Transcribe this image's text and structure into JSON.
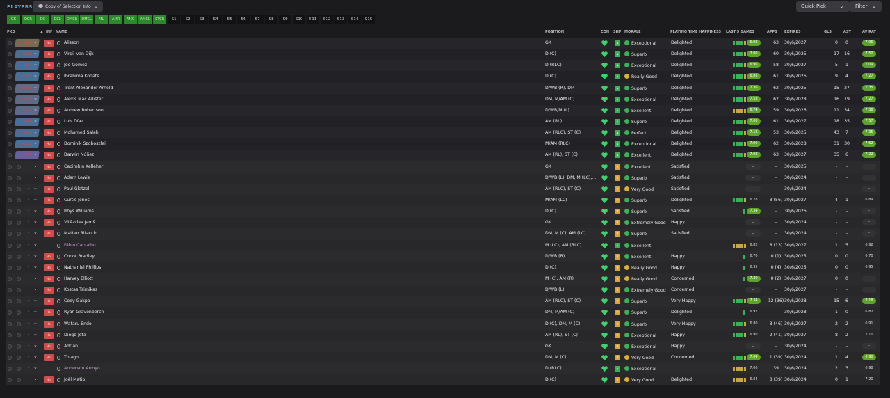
{
  "header": {
    "section_title": "PLAYERS",
    "view_label": "Copy of Selection Info",
    "quick_pick": "Quick Pick",
    "filter": "Filter"
  },
  "positions": [
    "GK",
    "DCR",
    "DC",
    "DCL",
    "DMCR",
    "DMCL",
    "ML",
    "AMR",
    "AMC",
    "AMCL",
    "STCR"
  ],
  "subs": [
    "S1",
    "S2",
    "S3",
    "S4",
    "S5",
    "S6",
    "S7",
    "S8",
    "S9",
    "S10",
    "S11",
    "S12",
    "S13",
    "S14",
    "S15"
  ],
  "columns": {
    "pkd": "PKD",
    "inf": "INF",
    "name": "NAME",
    "position": "POSITION",
    "con": "CON",
    "shp": "SHP",
    "morale": "MORALE",
    "pth": "PLAYING TIME HAPPINESS",
    "last5": "LAST 5 GAMES",
    "apps": "APPS",
    "expires": "EXPIRES",
    "gls": "GLS",
    "ast": "AST",
    "avrat": "AV RAT"
  },
  "players": [
    {
      "slot": "GK",
      "name": "Alisson",
      "position": "GK",
      "morale": "Exceptional",
      "pth": "Delighted",
      "last5": "6.98",
      "apps": "63",
      "expires": "30/6/2027",
      "gls": "0",
      "ast": "0",
      "avrat": "7.06",
      "green5": true
    },
    {
      "slot": "DCR",
      "name": "Virgil van Dijk",
      "position": "D (C)",
      "morale": "Superb",
      "pth": "Delighted",
      "last5": "7.06",
      "apps": "60",
      "expires": "30/6/2025",
      "gls": "17",
      "ast": "16",
      "avrat": "7.50",
      "green5": true
    },
    {
      "slot": "DC",
      "name": "Joe Gomez",
      "position": "D (RLC)",
      "morale": "Exceptional",
      "pth": "Delighted",
      "last5": "6.96",
      "apps": "58",
      "expires": "30/6/2027",
      "gls": "5",
      "ast": "1",
      "avrat": "7.09",
      "green5": true
    },
    {
      "slot": "DCL",
      "name": "Ibrahima Konaté",
      "position": "D (C)",
      "morale": "Really Good",
      "pth": "Delighted",
      "last5": "6.88",
      "apps": "61",
      "expires": "30/6/2026",
      "gls": "9",
      "ast": "4",
      "avrat": "7.27",
      "green5": true
    },
    {
      "slot": "DMCR",
      "name": "Trent Alexander-Arnold",
      "position": "D/WB (R), DM",
      "morale": "Superb",
      "pth": "Delighted",
      "last5": "7.36",
      "apps": "62",
      "expires": "30/6/2025",
      "gls": "15",
      "ast": "27",
      "avrat": "7.35",
      "green5": true
    },
    {
      "slot": "DMCL",
      "name": "Alexis Mac Allister",
      "position": "DM, M/AM (C)",
      "morale": "Exceptional",
      "pth": "Delighted",
      "last5": "7.58",
      "apps": "62",
      "expires": "30/6/2028",
      "gls": "16",
      "ast": "19",
      "avrat": "7.27",
      "green5": true
    },
    {
      "slot": "ML",
      "name": "Andrew Robertson",
      "position": "D/WB/M (L)",
      "morale": "Excellent",
      "pth": "Delighted",
      "last5": "6.74",
      "apps": "59",
      "expires": "30/6/2026",
      "gls": "11",
      "ast": "34",
      "avrat": "7.38",
      "green5": false
    },
    {
      "slot": "AMR",
      "name": "Luis Díaz",
      "position": "AM (RL)",
      "morale": "Superb",
      "pth": "Delighted",
      "last5": "7.06",
      "apps": "61",
      "expires": "30/6/2027",
      "gls": "18",
      "ast": "35",
      "avrat": "7.57",
      "green5": true
    },
    {
      "slot": "AMC",
      "name": "Mohamed Salah",
      "position": "AM (RLC), ST (C)",
      "morale": "Perfect",
      "pth": "Delighted",
      "last5": "7.18",
      "apps": "53",
      "expires": "30/6/2025",
      "gls": "43",
      "ast": "7",
      "avrat": "7.35",
      "green5": true
    },
    {
      "slot": "AMCL",
      "name": "Dominik Szoboszlai",
      "position": "M/AM (RLC)",
      "morale": "Exceptional",
      "pth": "Delighted",
      "last5": "7.06",
      "apps": "62",
      "expires": "30/6/2028",
      "gls": "31",
      "ast": "30",
      "avrat": "7.62",
      "green5": true
    },
    {
      "slot": "STCR",
      "name": "Darwin Núñez",
      "position": "AM (RL), ST (C)",
      "morale": "Excellent",
      "pth": "Delighted",
      "last5": "7.98",
      "apps": "63",
      "expires": "30/6/2027",
      "gls": "35",
      "ast": "6",
      "avrat": "7.22",
      "green5": true
    },
    {
      "slot": "",
      "name": "Caoimhin Kelleher",
      "position": "GK",
      "morale": "Excellent",
      "pth": "Satisfied",
      "last5": "-",
      "apps": "-",
      "expires": "30/6/2025",
      "gls": "-",
      "ast": "-",
      "avrat": "-"
    },
    {
      "slot": "",
      "name": "Adam Lewis",
      "position": "D/WB (L), DM, M (LC),...",
      "morale": "Superb",
      "pth": "Satisfied",
      "last5": "-",
      "apps": "-",
      "expires": "30/6/2024",
      "gls": "-",
      "ast": "-",
      "avrat": "-"
    },
    {
      "slot": "",
      "name": "Paul Glatzel",
      "position": "AM (RLC), ST (C)",
      "morale": "Very Good",
      "pth": "Satisfied",
      "last5": "-",
      "apps": "-",
      "expires": "30/6/2024",
      "gls": "-",
      "ast": "-",
      "avrat": "-"
    },
    {
      "slot": "",
      "name": "Curtis Jones",
      "position": "M/AM (LC)",
      "morale": "Superb",
      "pth": "Delighted",
      "last5": "6.78",
      "apps": "3 (56)",
      "expires": "30/6/2027",
      "gls": "4",
      "ast": "1",
      "avrat": "6.89",
      "green5": true,
      "plain": true
    },
    {
      "slot": "",
      "name": "Rhys Williams",
      "position": "D (C)",
      "morale": "Superb",
      "pth": "Satisfied",
      "last5": "7.34",
      "apps": "-",
      "expires": "30/6/2026",
      "gls": "-",
      "ast": "-",
      "avrat": "-",
      "single": true
    },
    {
      "slot": "",
      "name": "Vitězslav Jaroš",
      "position": "GK",
      "morale": "Extremely Good",
      "pth": "Happy",
      "last5": "-",
      "apps": "-",
      "expires": "30/6/2024",
      "gls": "-",
      "ast": "-",
      "avrat": "-"
    },
    {
      "slot": "",
      "name": "Matteo Ritaccio",
      "position": "DM, M (C), AM (LC)",
      "morale": "Superb",
      "pth": "Satisfied",
      "last5": "-",
      "apps": "-",
      "expires": "30/6/2024",
      "gls": "-",
      "ast": "-",
      "avrat": "-"
    },
    {
      "slot": "",
      "name": "Fábio Carvalho",
      "position": "M (LC), AM (RLC)",
      "morale": "Excellent",
      "pth": "",
      "last5": "6.82",
      "apps": "8 (13)",
      "expires": "30/6/2027",
      "gls": "1",
      "ast": "5",
      "avrat": "6.92",
      "loan": true,
      "yellow5": true,
      "plain": true
    },
    {
      "slot": "",
      "name": "Conor Bradley",
      "position": "D/WB (R)",
      "morale": "Excellent",
      "pth": "Happy",
      "last5": "6.70",
      "apps": "0 (1)",
      "expires": "30/6/2025",
      "gls": "0",
      "ast": "0",
      "avrat": "6.70",
      "plain": true,
      "single": true
    },
    {
      "slot": "",
      "name": "Nathaniel Phillips",
      "position": "D (C)",
      "morale": "Really Good",
      "pth": "Happy",
      "last5": "6.95",
      "apps": "0 (4)",
      "expires": "30/6/2025",
      "gls": "0",
      "ast": "0",
      "avrat": "6.95",
      "plain": true,
      "single": true
    },
    {
      "slot": "",
      "name": "Harvey Elliott",
      "position": "M (C), AM (R)",
      "morale": "Really Good",
      "pth": "Concerned",
      "last5": "7.30",
      "apps": "0 (2)",
      "expires": "30/6/2027",
      "gls": "0",
      "ast": "0",
      "avrat": "-",
      "single": true
    },
    {
      "slot": "",
      "name": "Kostas Tsimikas",
      "position": "D/WB (L)",
      "morale": "Extremely Good",
      "pth": "Concerned",
      "last5": "-",
      "apps": "-",
      "expires": "30/6/2027",
      "gls": "-",
      "ast": "-",
      "avrat": "-"
    },
    {
      "slot": "",
      "name": "Cody Gakpo",
      "position": "AM (RLC), ST (C)",
      "morale": "Superb",
      "pth": "Very Happy",
      "last5": "7.34",
      "apps": "12 (36)",
      "expires": "30/6/2028",
      "gls": "15",
      "ast": "6",
      "avrat": "7.18",
      "green5": true
    },
    {
      "slot": "",
      "name": "Ryan Gravenberch",
      "position": "DM, M/AM (C)",
      "morale": "Superb",
      "pth": "Delighted",
      "last5": "6.92",
      "apps": "-",
      "expires": "30/6/2028",
      "gls": "1",
      "ast": "0",
      "avrat": "6.87",
      "plain": true,
      "single": true
    },
    {
      "slot": "",
      "name": "Wataru Endo",
      "position": "D (C), DM, M (C)",
      "morale": "Superb",
      "pth": "Very Happy",
      "last5": "6.80",
      "apps": "3 (46)",
      "expires": "30/6/2027",
      "gls": "2",
      "ast": "2",
      "avrat": "6.91",
      "green5": true,
      "plain": true
    },
    {
      "slot": "",
      "name": "Diogo Jota",
      "position": "AM (RL), ST (C)",
      "morale": "Exceptional",
      "pth": "Happy",
      "last5": "6.90",
      "apps": "2 (41)",
      "expires": "30/6/2027",
      "gls": "8",
      "ast": "2",
      "avrat": "7.10",
      "green5": true,
      "plain": true
    },
    {
      "slot": "",
      "name": "Adrián",
      "position": "GK",
      "morale": "Exceptional",
      "pth": "Happy",
      "last5": "-",
      "apps": "-",
      "expires": "30/6/2024",
      "gls": "-",
      "ast": "-",
      "avrat": "-"
    },
    {
      "slot": "",
      "name": "Thiago",
      "position": "DM, M (C)",
      "morale": "Very Good",
      "pth": "Concerned",
      "last5": "7.04",
      "apps": "1 (39)",
      "expires": "30/6/2024",
      "gls": "1",
      "ast": "4",
      "avrat": "6.90",
      "green5": true
    },
    {
      "slot": "",
      "name": "Anderson Arroyo",
      "position": "D (RLC)",
      "morale": "Exceptional",
      "pth": "",
      "last5": "7.06",
      "apps": "39",
      "expires": "30/6/2024",
      "gls": "2",
      "ast": "3",
      "avrat": "6.98",
      "loan": true,
      "plain": true
    },
    {
      "slot": "",
      "name": "Joël Matip",
      "position": "D (C)",
      "morale": "Very Good",
      "pth": "Delighted",
      "last5": "6.84",
      "apps": "8 (39)",
      "expires": "30/6/2024",
      "gls": "0",
      "ast": "1",
      "avrat": "7.20",
      "yellow5": true,
      "plain": true
    }
  ],
  "ui": {
    "hol": "Hol",
    "arrow": "⌄",
    "dash": "-"
  }
}
